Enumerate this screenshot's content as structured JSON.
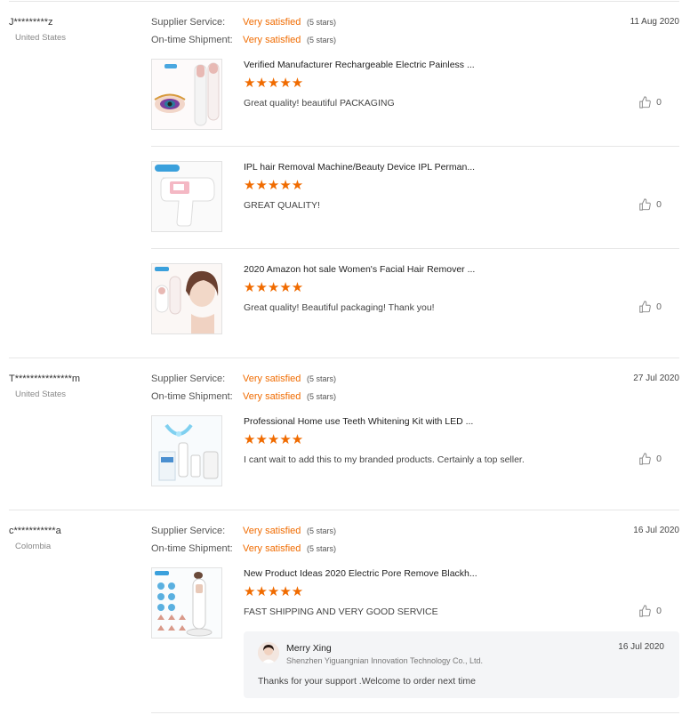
{
  "labels": {
    "supplier_service": "Supplier Service:",
    "ontime_shipment": "On-time Shipment:"
  },
  "reviews": [
    {
      "user": "J*********z",
      "country": "United States",
      "date": "11 Aug 2020",
      "supplier_service": {
        "value": "Very satisfied",
        "stars": "(5 stars)"
      },
      "ontime_shipment": {
        "value": "Very satisfied",
        "stars": "(5 stars)"
      },
      "products": [
        {
          "title": "Verified Manufacturer Rechargeable Electric Painless ...",
          "rating": 5,
          "stars_text": "★★★★★",
          "comment": "Great quality!  beautiful PACKAGING",
          "likes": "0"
        },
        {
          "title": "IPL hair Removal Machine/Beauty Device IPL Perman...",
          "rating": 5,
          "stars_text": "★★★★★",
          "comment": "GREAT QUALITY!",
          "likes": "0"
        },
        {
          "title": "2020 Amazon hot sale Women's Facial Hair Remover ...",
          "rating": 5,
          "stars_text": "★★★★★",
          "comment": "Great quality!  Beautiful packaging! Thank you!",
          "likes": "0"
        }
      ]
    },
    {
      "user": "T***************m",
      "country": "United States",
      "date": "27 Jul 2020",
      "supplier_service": {
        "value": "Very satisfied",
        "stars": "(5 stars)"
      },
      "ontime_shipment": {
        "value": "Very satisfied",
        "stars": "(5 stars)"
      },
      "products": [
        {
          "title": "Professional Home use Teeth Whitening Kit with LED ...",
          "rating": 5,
          "stars_text": "★★★★★",
          "comment": "I cant wait to add this to my branded products. Certainly a top seller.",
          "likes": "0"
        }
      ]
    },
    {
      "user": "c***********a",
      "country": "Colombia",
      "date": "16 Jul 2020",
      "supplier_service": {
        "value": "Very satisfied",
        "stars": "(5 stars)"
      },
      "ontime_shipment": {
        "value": "Very satisfied",
        "stars": "(5 stars)"
      },
      "products": [
        {
          "title": "New Product Ideas 2020 Electric Pore Remove Blackh...",
          "rating": 5,
          "stars_text": "★★★★★",
          "comment": "FAST SHIPPING AND VERY GOOD SERVICE",
          "likes": "0"
        }
      ],
      "reply": {
        "name": "Merry Xing",
        "company": "Shenzhen Yiguangnian Innovation Technology Co., Ltd.",
        "date": "16 Jul 2020",
        "text": "Thanks for your support .Welcome to order next time"
      }
    }
  ],
  "colors": {
    "accent": "#f06b00",
    "divider": "#e6e6e6",
    "reply_bg": "#f4f5f7"
  },
  "icons": {
    "like": "thumbs-up-icon",
    "star": "star-icon"
  }
}
